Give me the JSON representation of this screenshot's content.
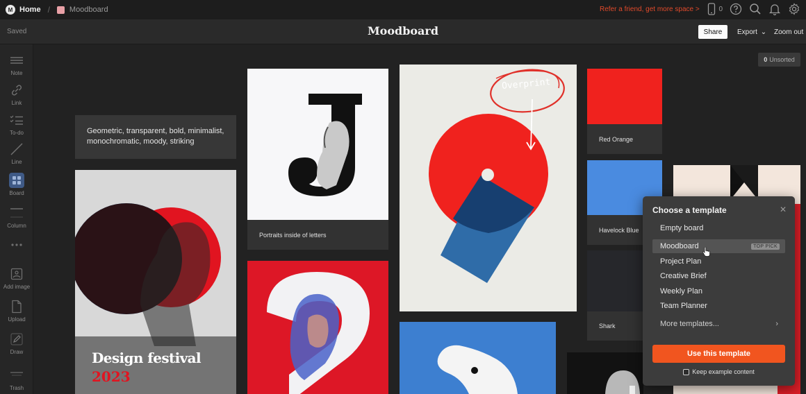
{
  "topbar": {
    "home_label": "Home",
    "breadcrumb_separator": "/",
    "board_name": "Moodboard",
    "board_color": "#e8a0a6",
    "refer_text": "Refer a friend, get more space >",
    "device_count": "0",
    "icons": [
      "mobile-icon",
      "help-icon",
      "search-icon",
      "bell-icon",
      "gear-icon"
    ]
  },
  "toolbar": {
    "saved_label": "Saved",
    "title": "Moodboard",
    "share_label": "Share",
    "export_label": "Export",
    "export_chevron": "⌄",
    "zoom_out_label": "Zoom out"
  },
  "sidebar": {
    "tools": [
      {
        "label": "Note",
        "icon": "note-icon"
      },
      {
        "label": "Link",
        "icon": "link-icon"
      },
      {
        "label": "To-do",
        "icon": "todo-icon"
      },
      {
        "label": "Line",
        "icon": "line-icon"
      },
      {
        "label": "Board",
        "icon": "board-icon",
        "active": true
      },
      {
        "label": "Column",
        "icon": "column-icon"
      },
      {
        "label": "",
        "icon": "more-icon"
      },
      {
        "label": "Add image",
        "icon": "image-icon"
      },
      {
        "label": "Upload",
        "icon": "upload-icon"
      },
      {
        "label": "Draw",
        "icon": "pencil-icon"
      },
      {
        "label": "Trash",
        "icon": "trash-icon"
      }
    ]
  },
  "canvas": {
    "unsorted_count": "0",
    "unsorted_label": "Unsorted",
    "note_text": "Geometric, transparent, bold, minimalist, monochromatic, moody, striking",
    "portrait_caption": "Portraits inside of letters",
    "overprint_text": "Overprint",
    "festival_title": "Design festival",
    "festival_year": "2023",
    "swatches": [
      {
        "name": "Red Orange",
        "color": "#f0221e"
      },
      {
        "name": "Havelock Blue",
        "color": "#4a8be0"
      },
      {
        "name": "Shark",
        "color": "#26272b"
      }
    ]
  },
  "template_panel": {
    "title": "Choose a template",
    "close": "✕",
    "items": [
      {
        "label": "Empty board"
      },
      {
        "label": "Moodboard",
        "badge": "TOP PICK",
        "selected": true
      },
      {
        "label": "Project Plan"
      },
      {
        "label": "Creative Brief"
      },
      {
        "label": "Weekly Plan"
      },
      {
        "label": "Team Planner"
      }
    ],
    "more_label": "More templates...",
    "more_chevron": "›",
    "use_button": "Use this template",
    "keep_label": "Keep example content"
  },
  "colors": {
    "accent": "#f1551f",
    "refer": "#e04a2b",
    "poster_red": "#f0221e",
    "poster_blue": "#2f6ca8"
  }
}
